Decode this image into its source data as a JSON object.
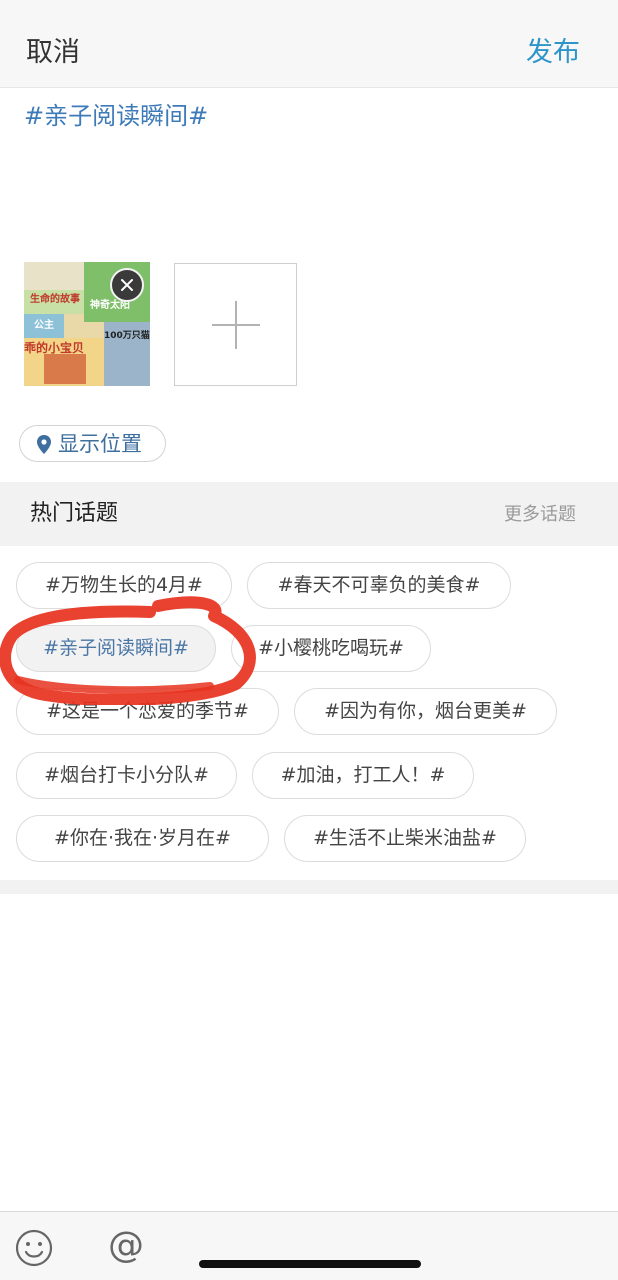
{
  "header": {
    "cancel_label": "取消",
    "publish_label": "发布"
  },
  "compose": {
    "text": "#亲子阅读瞬间#",
    "image_texts": [
      "生命的故事",
      "神奇太阳",
      "公主",
      "乖的小宝贝",
      "100万只猫"
    ]
  },
  "location": {
    "label": "显示位置",
    "icon": "location-pin-icon"
  },
  "hot_topics": {
    "title": "热门话题",
    "more_label": "更多话题",
    "items": [
      {
        "label": "#万物生长的4月#",
        "selected": false
      },
      {
        "label": "#春天不可辜负的美食#",
        "selected": false
      },
      {
        "label": "#亲子阅读瞬间#",
        "selected": true
      },
      {
        "label": "#小樱桃吃喝玩#",
        "selected": false
      },
      {
        "label": "#这是一个恋爱的季节#",
        "selected": false
      },
      {
        "label": "#因为有你，烟台更美#",
        "selected": false
      },
      {
        "label": "#烟台打卡小分队#",
        "selected": false
      },
      {
        "label": "#加油，打工人！#",
        "selected": false
      },
      {
        "label": "#你在·我在·岁月在#",
        "selected": false
      },
      {
        "label": "#生活不止柴米油盐#",
        "selected": false
      }
    ]
  },
  "toolbar": {
    "emoji_icon": "emoji-icon",
    "at_label": "@"
  },
  "colors": {
    "accent": "#2e95c8",
    "topic_text": "#3d7ab8",
    "annotation": "#e8321e"
  }
}
